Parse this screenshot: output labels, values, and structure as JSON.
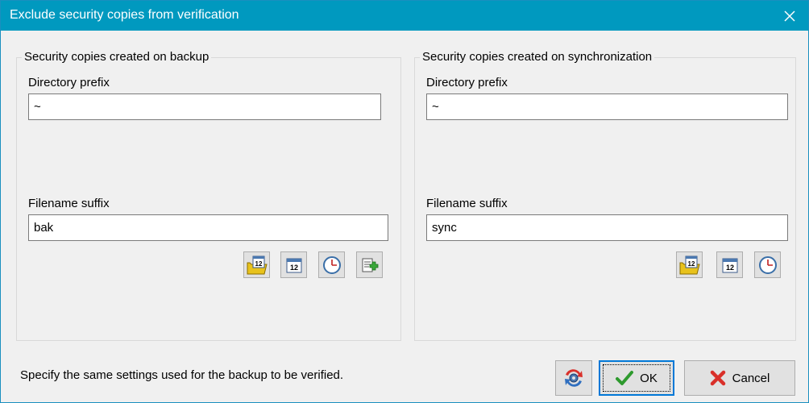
{
  "window": {
    "title": "Exclude security copies from verification",
    "close_glyph": "✕"
  },
  "backup_group": {
    "legend": "Security copies created on backup",
    "dir_prefix_label": "Directory prefix",
    "dir_prefix_value": "~",
    "suffix_label": "Filename suffix",
    "suffix_value": "bak",
    "buttons": [
      "folder-calendar-icon",
      "calendar-icon",
      "clock-icon",
      "add-document-icon"
    ]
  },
  "sync_group": {
    "legend": "Security copies created on synchronization",
    "dir_prefix_label": "Directory prefix",
    "dir_prefix_value": "~",
    "suffix_label": "Filename suffix",
    "suffix_value": "sync",
    "buttons": [
      "folder-calendar-icon",
      "calendar-icon",
      "clock-icon"
    ]
  },
  "calendar_day": "12",
  "footer": {
    "hint": "Specify the same settings used for the backup to be verified.",
    "ok_label": "OK",
    "cancel_label": "Cancel"
  },
  "colors": {
    "titlebar": "#0099bf",
    "ok_check": "#2e9a2e",
    "cancel_x": "#d9302a",
    "default_button_border": "#0078d7"
  }
}
